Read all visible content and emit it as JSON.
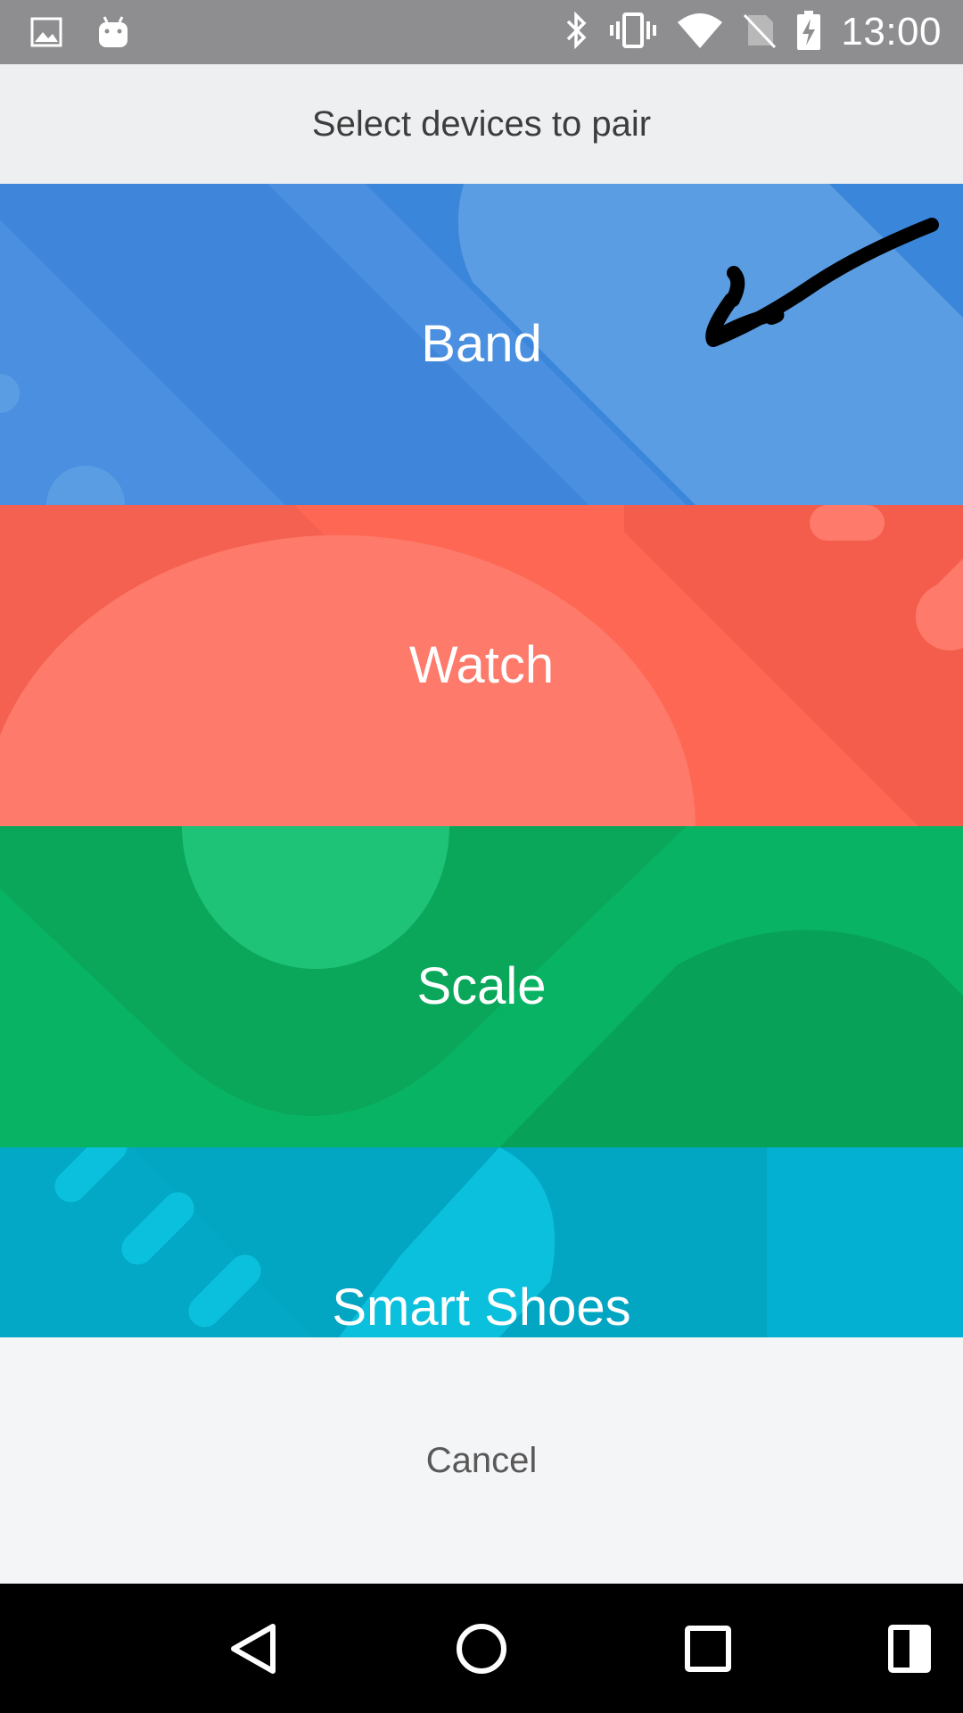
{
  "status_bar": {
    "time": "13:00",
    "icons": [
      "image-icon",
      "android-icon",
      "bluetooth-icon",
      "vibrate-icon",
      "wifi-icon",
      "no-sim-icon",
      "battery-charging-icon"
    ]
  },
  "dialog": {
    "title": "Select devices to pair",
    "cancel_label": "Cancel"
  },
  "devices": [
    {
      "label": "Band",
      "color": "#4a8fe0"
    },
    {
      "label": "Watch",
      "color": "#fe6753"
    },
    {
      "label": "Scale",
      "color": "#08b463"
    },
    {
      "label": "Smart Shoes",
      "color": "#03b0d1"
    }
  ],
  "nav_bar": {
    "icons": [
      "back-icon",
      "home-icon",
      "recents-icon",
      "split-screen-icon"
    ]
  }
}
